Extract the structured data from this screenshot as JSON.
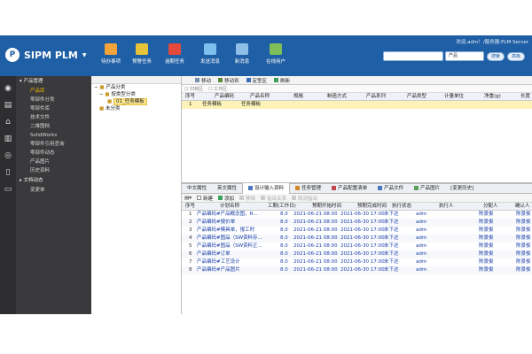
{
  "header": {
    "app_name": "SIPM PLM",
    "user_info": "欢迎,adm！/服务器:PLM Server",
    "buttons": [
      {
        "label": "待办事项",
        "color": "#f2a33a"
      },
      {
        "label": "预警任务",
        "color": "#e6c43a"
      },
      {
        "label": "逾期任务",
        "color": "#e5493a"
      },
      {
        "label": "发送消息",
        "color": "#7cc0ef"
      },
      {
        "label": "新消息",
        "color": "#8fbfe8"
      },
      {
        "label": "在线用户",
        "color": "#7fbf5a"
      }
    ],
    "search": {
      "scope": "产品",
      "search_label": "搜索",
      "advanced_label": "高级"
    }
  },
  "nav": {
    "product_group": "产品管理",
    "items": [
      "产品库",
      "零部件分类",
      "零部件库",
      "技术文件",
      "二维图档",
      "SolidWorks",
      "零部件引用查询",
      "零部件动态",
      "产品图片",
      "历史资料"
    ],
    "doc_group": "文档动态",
    "doc_items": [
      "变更单"
    ]
  },
  "tree": {
    "root": "产品分类",
    "child": "按类型分类",
    "leaf": "01_任务模板",
    "other": "未分类"
  },
  "actions": [
    "移动",
    "移动到",
    "定型区",
    "刷新"
  ],
  "subfilters": [
    "归档区",
    "工作区"
  ],
  "top_grid": {
    "headers": [
      "序号",
      "产品编码",
      "产品名称",
      "规格",
      "制造方式",
      "产品系列",
      "产品类型",
      "计量单位",
      "净重(g)",
      "长度"
    ],
    "rows": [
      [
        "1",
        "任务模板",
        "任务模板",
        "",
        "",
        "",
        "",
        "",
        "",
        ""
      ]
    ]
  },
  "tabs": [
    "中文属性",
    "英文属性",
    "设计输入资料",
    "任务管理",
    "产品配置清单",
    "产品文件",
    "产品图片",
    "[变更历史]"
  ],
  "tab_active": 2,
  "sub_toolbar": [
    "新建",
    "添加",
    "移除",
    "指出关系",
    "取消指出"
  ],
  "bottom_grid": {
    "headers": [
      "序号",
      "计划名称",
      "工期(工作日)",
      "预期开始时间",
      "预期完成时间",
      "执行状态",
      "执行人",
      "分配人",
      "确认人"
    ],
    "rows": [
      [
        "1",
        "产品编码#产品概念图，R...",
        "8.0",
        "2021-06-21 08:00",
        "2021-06-30 17:00",
        "未下达",
        "adm",
        "陈景俊",
        "陈景俊"
      ],
      [
        "2",
        "产品编码#报价单",
        "8.0",
        "2021-06-21 08:00",
        "2021-06-30 17:00",
        "未下达",
        "adm",
        "陈景俊",
        "陈景俊"
      ],
      [
        "3",
        "产品编码#模具单，报工时",
        "8.0",
        "2021-06-21 08:00",
        "2021-06-30 17:00",
        "未下达",
        "adm",
        "陈景俊",
        "陈景俊"
      ],
      [
        "4",
        "产品编码#图品（SW资料存...",
        "8.0",
        "2021-06-21 08:00",
        "2021-06-30 17:00",
        "未下达",
        "adm",
        "陈景俊",
        "陈景俊"
      ],
      [
        "5",
        "产品编码#图品（SW资料正...",
        "8.0",
        "2021-06-21 08:00",
        "2021-06-30 17:00",
        "未下达",
        "adm",
        "陈景俊",
        "陈景俊"
      ],
      [
        "6",
        "产品编码#订单",
        "8.0",
        "2021-06-21 08:00",
        "2021-06-30 17:00",
        "未下达",
        "adm",
        "陈景俊",
        "陈景俊"
      ],
      [
        "7",
        "产品编码#工艺设计",
        "8.0",
        "2021-06-21 08:00",
        "2021-06-30 17:00",
        "未下达",
        "adm",
        "陈景俊",
        "陈景俊"
      ],
      [
        "8",
        "产品编码#产品图片",
        "8.0",
        "2021-06-21 08:00",
        "2021-06-30 17:00",
        "未下达",
        "adm",
        "陈景俊",
        "陈景俊"
      ]
    ]
  }
}
